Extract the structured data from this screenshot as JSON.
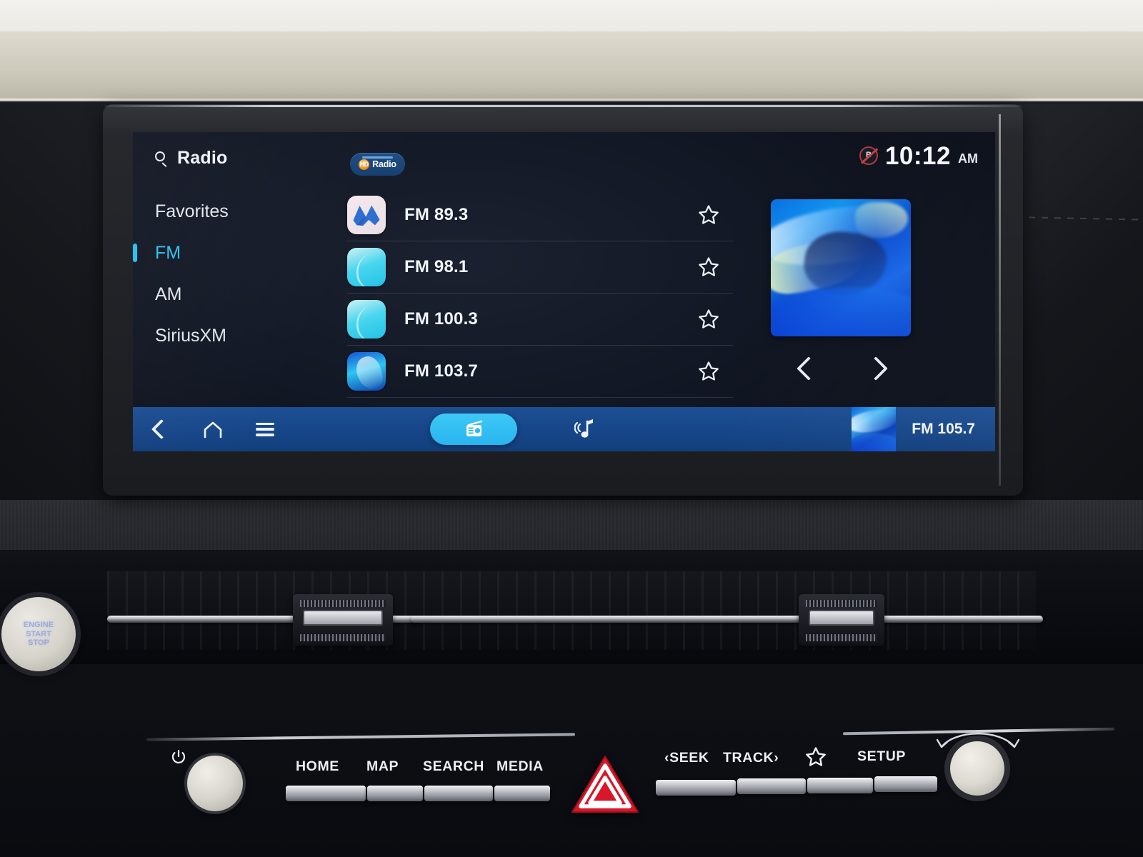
{
  "screen": {
    "header": {
      "search_icon": "search-icon",
      "title": "Radio",
      "hd_badge": {
        "mark": "HD",
        "label": "Radio"
      },
      "status": {
        "bluetooth_icon": "bluetooth-muted-icon",
        "bt_letter": "B",
        "time": "10:12",
        "meridiem": "AM"
      }
    },
    "sidebar": {
      "items": [
        {
          "label": "Favorites",
          "selected": false
        },
        {
          "label": "FM",
          "selected": true
        },
        {
          "label": "AM",
          "selected": false
        },
        {
          "label": "SiriusXM",
          "selected": false
        }
      ]
    },
    "stations": [
      {
        "name": "FM 89.3",
        "favorite": false
      },
      {
        "name": "FM 98.1",
        "favorite": false
      },
      {
        "name": "FM 100.3",
        "favorite": false
      },
      {
        "name": "FM 103.7",
        "favorite": false
      }
    ],
    "preview": {
      "art_alt": "album-art",
      "prev_label": "‹",
      "next_label": "›"
    },
    "dock": {
      "back_icon": "back-arrow-icon",
      "home_icon": "home-icon",
      "menu_icon": "hamburger-menu-icon",
      "radio_icon": "radio-icon",
      "media_icon": "music-note-icon",
      "now_playing": "FM 105.7"
    }
  },
  "hardware": {
    "start_stop": "ENGINE\nSTART\nSTOP",
    "start_stop_lines": [
      "ENGINE",
      "START",
      "STOP"
    ],
    "power_icon": "power-icon",
    "buttons_left": [
      "HOME",
      "MAP",
      "SEARCH",
      "MEDIA"
    ],
    "buttons_right": [
      "‹SEEK",
      "TRACK›",
      "",
      "SETUP"
    ],
    "favorite_icon": "star-icon",
    "hazard_icon": "hazard-triangle-icon",
    "tune_knob": "tune-knob",
    "volume_knob": "power-volume-knob"
  },
  "colors": {
    "accent_cyan": "#22c0f2",
    "dock_blue": "#17478a",
    "hazard_red": "#d8172a",
    "hd_orange": "#f08a17"
  }
}
